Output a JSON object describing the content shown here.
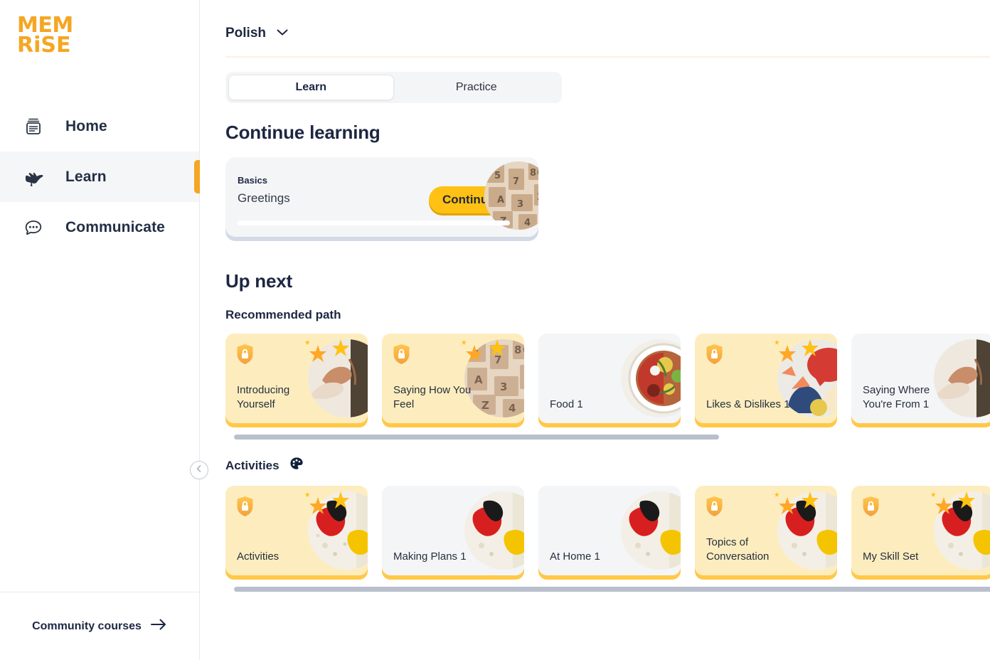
{
  "brand": {
    "logo_line1": "MEM",
    "logo_line2": "RiSE",
    "logo_color": "#F5A623"
  },
  "sidebar": {
    "items": [
      {
        "label": "Home",
        "icon": "cards-icon",
        "active": false
      },
      {
        "label": "Learn",
        "icon": "hand-pointer-icon",
        "active": true
      },
      {
        "label": "Communicate",
        "icon": "speech-bubble-icon",
        "active": false
      }
    ],
    "community_link": "Community courses",
    "community_icon": "arrow-right-icon",
    "collapse_icon": "chevron-left-icon"
  },
  "header": {
    "language": "Polish",
    "language_chevron": "chevron-down-icon"
  },
  "tabs": [
    {
      "label": "Learn",
      "active": true
    },
    {
      "label": "Practice",
      "active": false
    }
  ],
  "continue_learning": {
    "heading": "Continue learning",
    "card": {
      "kicker": "Basics",
      "title": "Greetings",
      "button": "Continue",
      "progress_percent": 0,
      "thumbnail": "wooden-letterpress-type"
    }
  },
  "up_next": {
    "heading": "Up next",
    "sections": [
      {
        "label": "Recommended path",
        "icon": null,
        "cards": [
          {
            "title": "Introducing Yourself",
            "locked": true,
            "starred": true,
            "image": "hands-greeting"
          },
          {
            "title": "Saying How You Feel",
            "locked": true,
            "starred": true,
            "image": "wooden-letterpress-type"
          },
          {
            "title": "Food 1",
            "locked": false,
            "starred": false,
            "image": "salad-bowl"
          },
          {
            "title": "Likes & Dislikes 1",
            "locked": true,
            "starred": true,
            "image": "speech-bubbles-illustration"
          },
          {
            "title": "Saying Where You're From 1",
            "locked": false,
            "starred": false,
            "image": "hands-greeting"
          }
        ]
      },
      {
        "label": "Activities",
        "icon": "palette-icon",
        "cards": [
          {
            "title": "Activities",
            "locked": true,
            "starred": true,
            "image": "paint-palette"
          },
          {
            "title": "Making Plans 1",
            "locked": false,
            "starred": false,
            "image": "paint-palette"
          },
          {
            "title": "At Home 1",
            "locked": false,
            "starred": false,
            "image": "paint-palette"
          },
          {
            "title": "Topics of Conversation",
            "locked": true,
            "starred": true,
            "image": "paint-palette"
          },
          {
            "title": "My Skill Set",
            "locked": true,
            "starred": true,
            "image": "paint-palette"
          }
        ]
      }
    ]
  },
  "colors": {
    "brand_orange": "#F5A623",
    "accent_yellow": "#FFC113",
    "card_cream": "#FDEDBE",
    "card_shadow_yellow": "#FFC847",
    "card_plain": "#F4F5F6",
    "text_dark": "#1D2742",
    "scrollbar": "#B9BFCD"
  }
}
